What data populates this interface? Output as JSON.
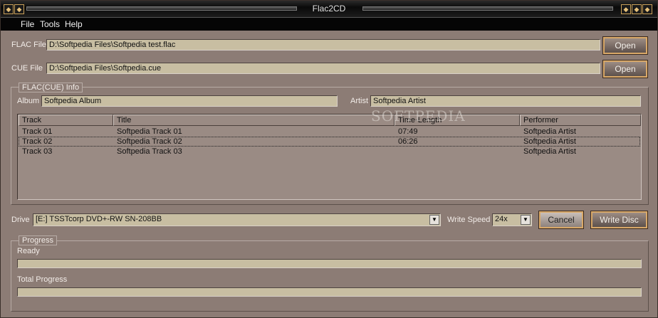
{
  "window": {
    "title": "Flac2CD"
  },
  "menu": [
    {
      "label": "File"
    },
    {
      "label": "Tools"
    },
    {
      "label": "Help"
    }
  ],
  "flac": {
    "label": "FLAC File",
    "value": "D:\\Softpedia Files\\Softpedia test.flac",
    "open_label": "Open"
  },
  "cue": {
    "label": "CUE File",
    "value": "D:\\Softpedia Files\\Softpedia.cue",
    "open_label": "Open"
  },
  "info": {
    "group_title": "FLAC(CUE) Info",
    "album_label": "Album",
    "album_value": "Softpedia Album",
    "artist_label": "Artist",
    "artist_value": "Softpedia Artist"
  },
  "tracks": {
    "columns": [
      "Track",
      "Title",
      "Time-Length",
      "Performer"
    ],
    "rows": [
      {
        "track": "Track 01",
        "title": "Softpedia Track 01",
        "time": "07:49",
        "performer": "Softpedia Artist"
      },
      {
        "track": "Track 02",
        "title": "Softpedia Track 02",
        "time": "06:26",
        "performer": "Softpedia Artist"
      },
      {
        "track": "Track 03",
        "title": "Softpedia Track 03",
        "time": "",
        "performer": "Softpedia Artist"
      }
    ]
  },
  "drive": {
    "label": "Drive",
    "value": "[E:] TSSTcorp DVD+-RW SN-208BB"
  },
  "speed": {
    "label": "Write Speed",
    "value": "24x"
  },
  "actions": {
    "cancel_label": "Cancel",
    "write_label": "Write Disc"
  },
  "progress": {
    "group_title": "Progress",
    "status": "Ready",
    "current_fraction": 0,
    "total_label": "Total Progress",
    "total_fraction": 0
  },
  "watermark": "SOFTPEDIA",
  "icons": {
    "window_left": "ornament-icon",
    "window_right": [
      "minimize-icon",
      "maximize-icon",
      "close-icon"
    ],
    "combo": "chevron-down-icon"
  }
}
